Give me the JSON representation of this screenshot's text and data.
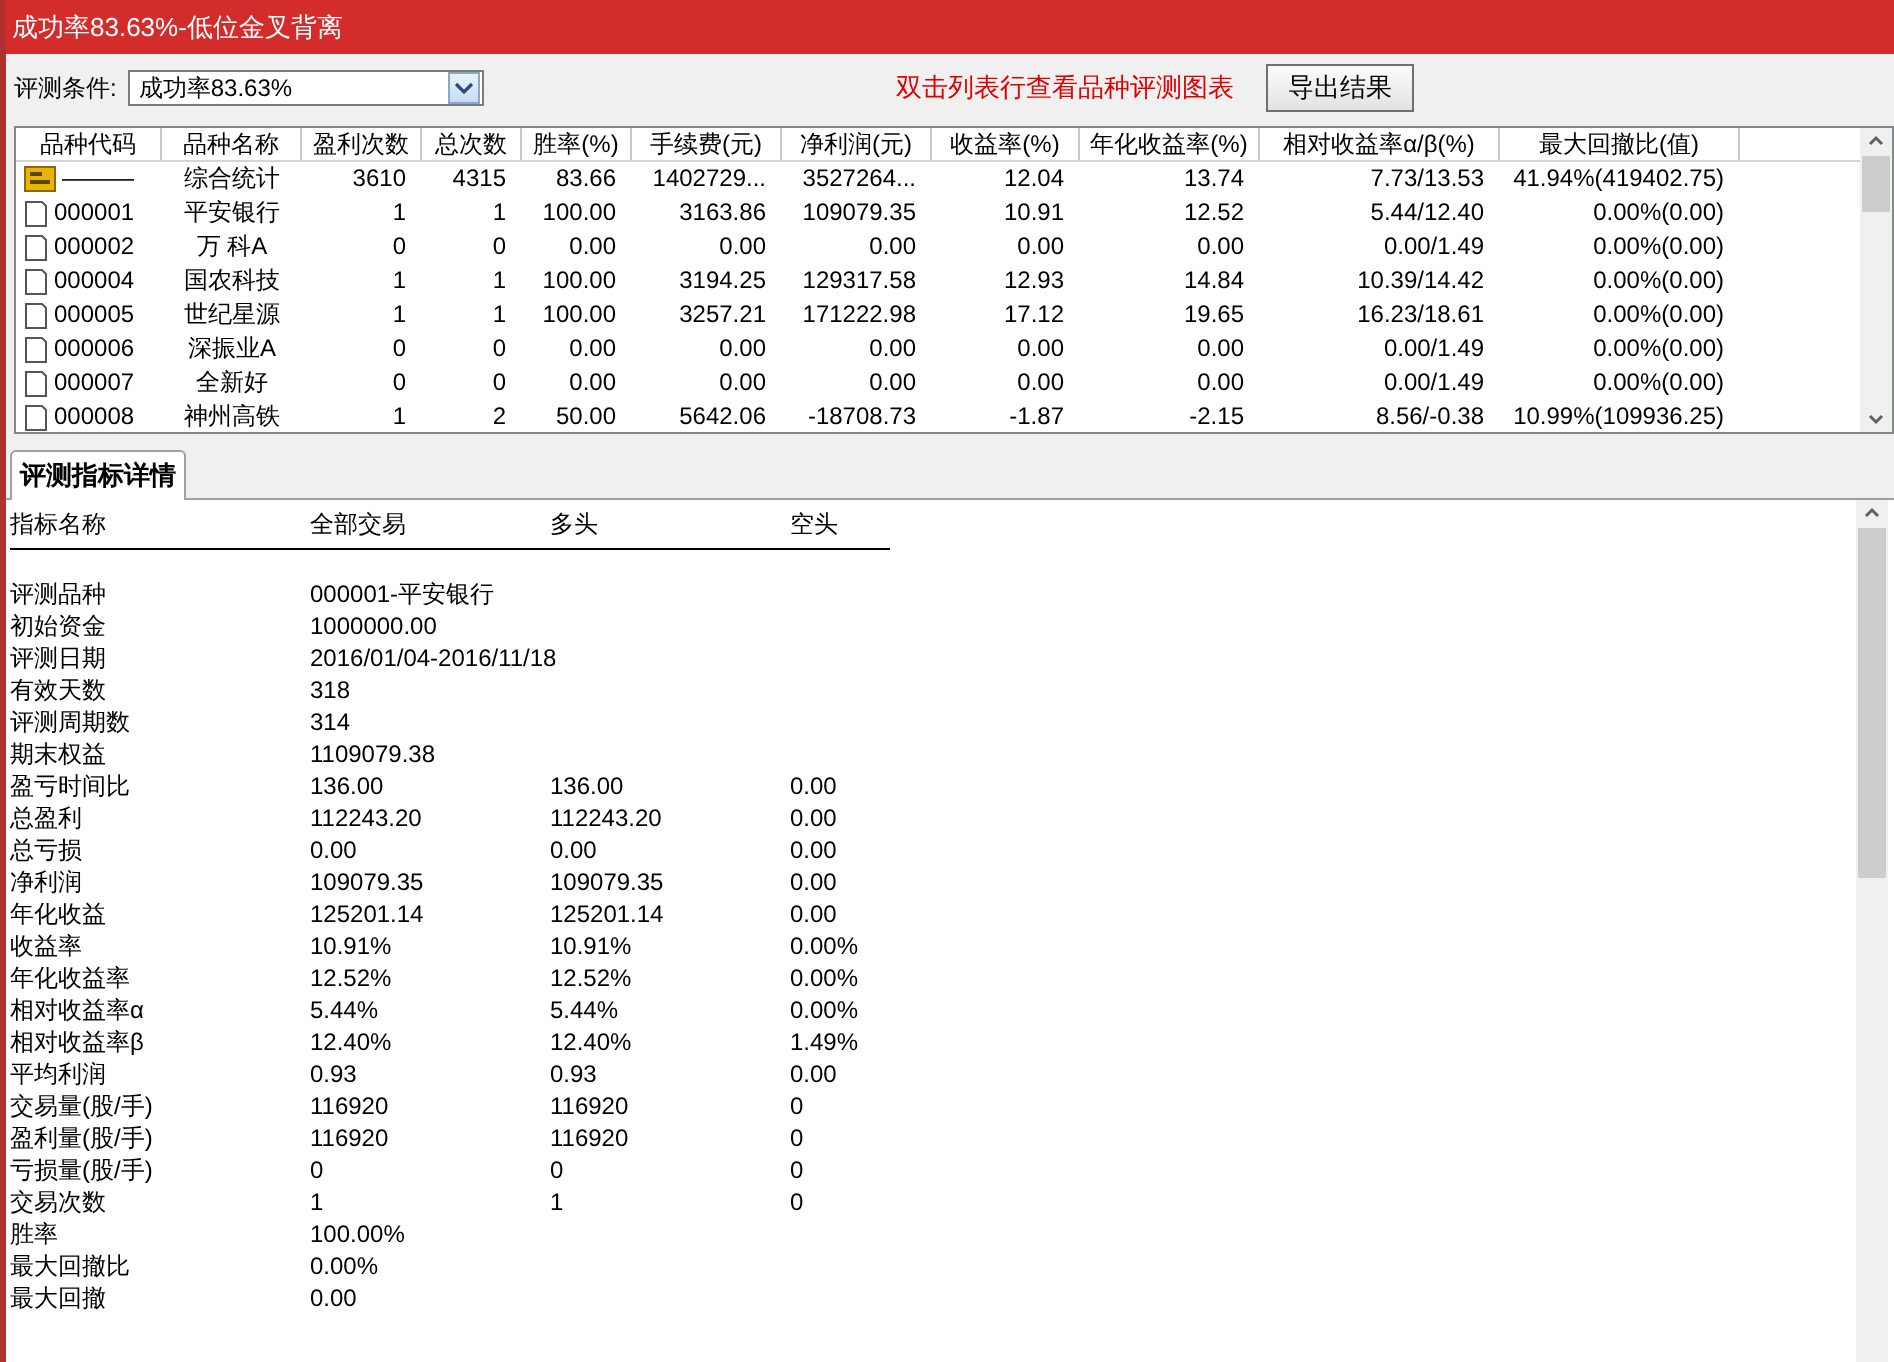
{
  "window": {
    "title": "成功率83.63%-低位金叉背离"
  },
  "filter": {
    "label": "评测条件:",
    "value": "成功率83.63%"
  },
  "hint": "双击列表行查看品种评测图表",
  "export_button": "导出结果",
  "table": {
    "columns": [
      "品种代码",
      "品种名称",
      "盈利次数",
      "总次数",
      "胜率(%)",
      "手续费(元)",
      "净利润(元)",
      "收益率(%)",
      "年化收益率(%)",
      "相对收益率α/β(%)",
      "最大回撤比(值)"
    ],
    "rows": [
      {
        "kind": "summary",
        "cells": [
          "———",
          "综合统计",
          "3610",
          "4315",
          "83.66",
          "1402729...",
          "3527264...",
          "12.04",
          "13.74",
          "7.73/13.53",
          "41.94%(419402.75)"
        ]
      },
      {
        "kind": "stock",
        "cells": [
          "000001",
          "平安银行",
          "1",
          "1",
          "100.00",
          "3163.86",
          "109079.35",
          "10.91",
          "12.52",
          "5.44/12.40",
          "0.00%(0.00)"
        ]
      },
      {
        "kind": "stock",
        "cells": [
          "000002",
          "万 科A",
          "0",
          "0",
          "0.00",
          "0.00",
          "0.00",
          "0.00",
          "0.00",
          "0.00/1.49",
          "0.00%(0.00)"
        ]
      },
      {
        "kind": "stock",
        "cells": [
          "000004",
          "国农科技",
          "1",
          "1",
          "100.00",
          "3194.25",
          "129317.58",
          "12.93",
          "14.84",
          "10.39/14.42",
          "0.00%(0.00)"
        ]
      },
      {
        "kind": "stock",
        "cells": [
          "000005",
          "世纪星源",
          "1",
          "1",
          "100.00",
          "3257.21",
          "171222.98",
          "17.12",
          "19.65",
          "16.23/18.61",
          "0.00%(0.00)"
        ]
      },
      {
        "kind": "stock",
        "cells": [
          "000006",
          "深振业A",
          "0",
          "0",
          "0.00",
          "0.00",
          "0.00",
          "0.00",
          "0.00",
          "0.00/1.49",
          "0.00%(0.00)"
        ]
      },
      {
        "kind": "stock",
        "cells": [
          "000007",
          "全新好",
          "0",
          "0",
          "0.00",
          "0.00",
          "0.00",
          "0.00",
          "0.00",
          "0.00/1.49",
          "0.00%(0.00)"
        ]
      },
      {
        "kind": "stock",
        "cells": [
          "000008",
          "神州高铁",
          "1",
          "2",
          "50.00",
          "5642.06",
          "-18708.73",
          "-1.87",
          "-2.15",
          "8.56/-0.38",
          "10.99%(109936.25)"
        ]
      }
    ]
  },
  "details_tab": {
    "label": "评测指标详情",
    "selected": true
  },
  "details": {
    "columns": [
      "指标名称",
      "全部交易",
      "多头",
      "空头"
    ],
    "rows": [
      {
        "name": "评测品种",
        "values": [
          "000001-平安银行"
        ]
      },
      {
        "name": "初始资金",
        "values": [
          "1000000.00"
        ]
      },
      {
        "name": "评测日期",
        "values": [
          "2016/01/04-2016/11/18"
        ]
      },
      {
        "name": "有效天数",
        "values": [
          "318"
        ]
      },
      {
        "name": "评测周期数",
        "values": [
          "314"
        ]
      },
      {
        "name": "期末权益",
        "values": [
          "1109079.38"
        ]
      },
      {
        "name": "盈亏时间比",
        "values": [
          "136.00",
          "136.00",
          "0.00"
        ]
      },
      {
        "name": "总盈利",
        "values": [
          "112243.20",
          "112243.20",
          "0.00"
        ]
      },
      {
        "name": "总亏损",
        "values": [
          "0.00",
          "0.00",
          "0.00"
        ]
      },
      {
        "name": "净利润",
        "values": [
          "109079.35",
          "109079.35",
          "0.00"
        ]
      },
      {
        "name": "年化收益",
        "values": [
          "125201.14",
          "125201.14",
          "0.00"
        ]
      },
      {
        "name": "收益率",
        "values": [
          "10.91%",
          "10.91%",
          "0.00%"
        ]
      },
      {
        "name": "年化收益率",
        "values": [
          "12.52%",
          "12.52%",
          "0.00%"
        ]
      },
      {
        "name": "相对收益率α",
        "values": [
          "5.44%",
          "5.44%",
          "0.00%"
        ]
      },
      {
        "name": "相对收益率β",
        "values": [
          "12.40%",
          "12.40%",
          "1.49%"
        ]
      },
      {
        "name": "平均利润",
        "values": [
          "0.93",
          "0.93",
          "0.00"
        ]
      },
      {
        "name": "交易量(股/手)",
        "values": [
          "116920",
          "116920",
          "0"
        ]
      },
      {
        "name": "盈利量(股/手)",
        "values": [
          "116920",
          "116920",
          "0"
        ]
      },
      {
        "name": "亏损量(股/手)",
        "values": [
          "0",
          "0",
          "0"
        ]
      },
      {
        "name": "交易次数",
        "values": [
          "1",
          "1",
          "0"
        ]
      },
      {
        "name": "胜率",
        "values": [
          "100.00%"
        ]
      },
      {
        "name": "最大回撤比",
        "values": [
          "0.00%"
        ]
      },
      {
        "name": "最大回撤",
        "values": [
          "0.00"
        ]
      }
    ]
  }
}
